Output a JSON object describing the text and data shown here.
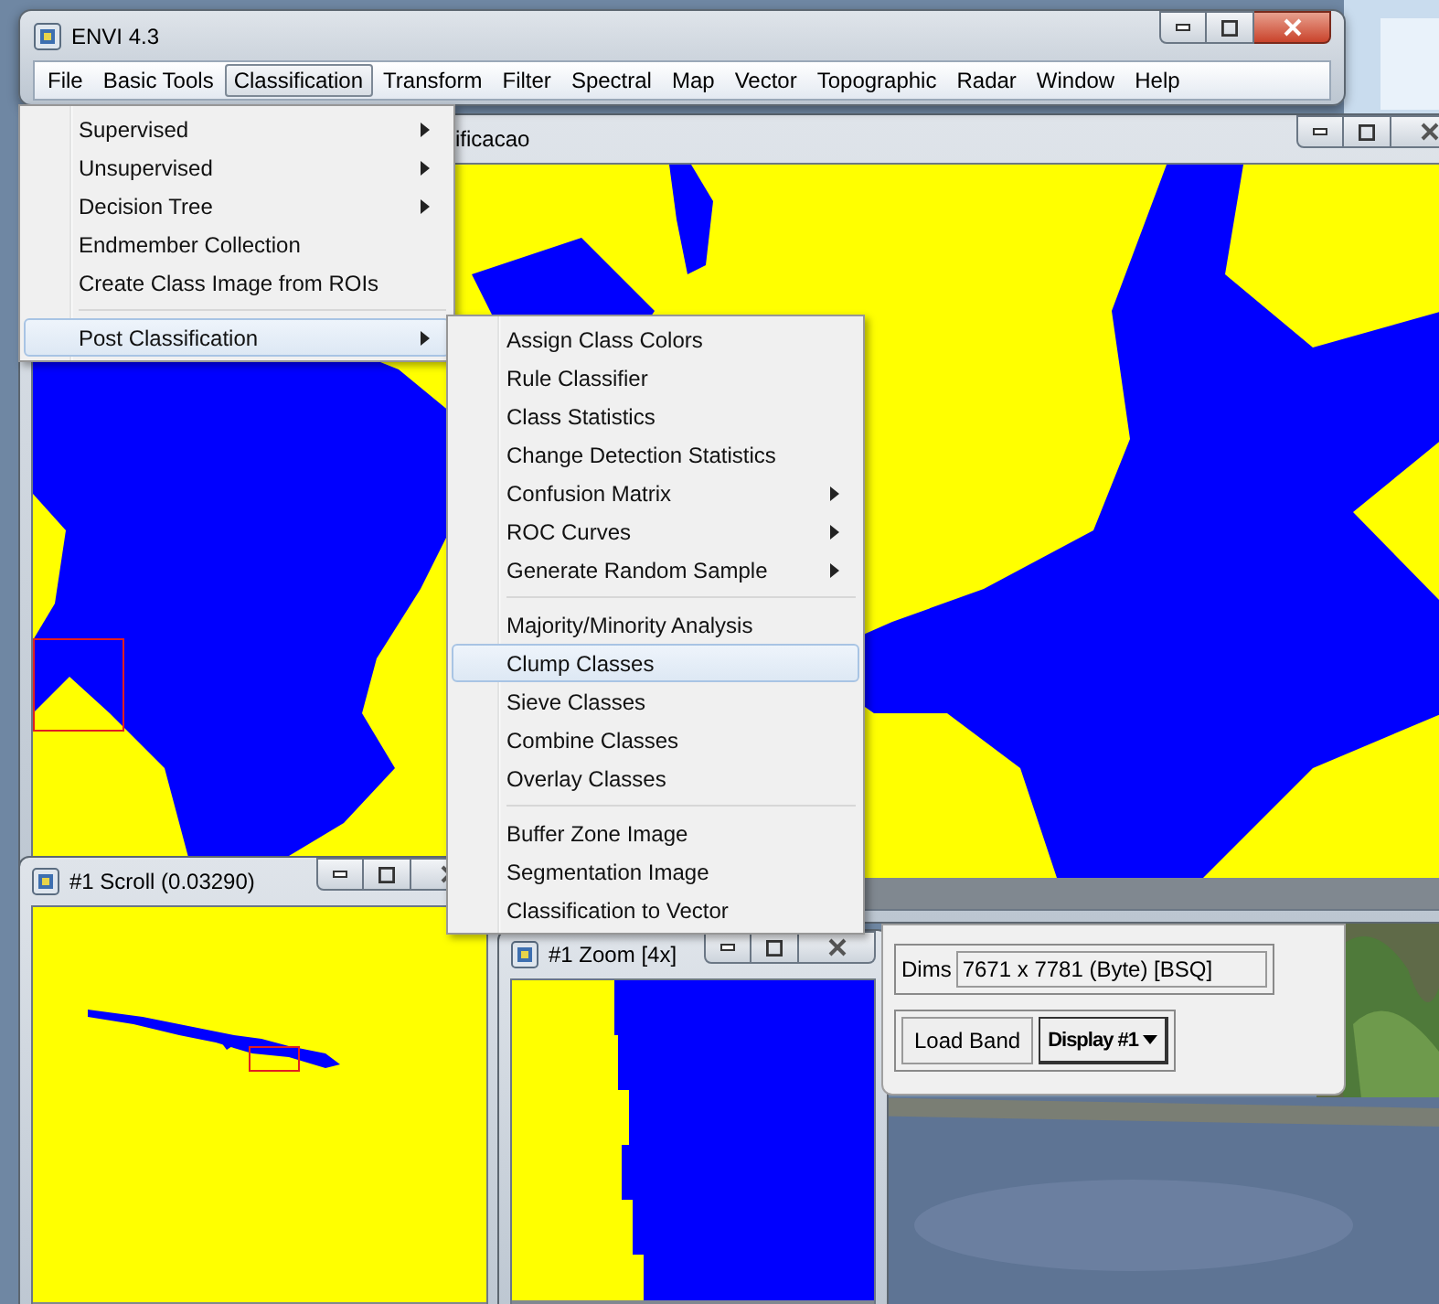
{
  "main_window": {
    "title": "ENVI 4.3",
    "menu": [
      {
        "label": "File",
        "selected": false
      },
      {
        "label": "Basic Tools",
        "selected": false
      },
      {
        "label": "Classification",
        "selected": true
      },
      {
        "label": "Transform",
        "selected": false
      },
      {
        "label": "Filter",
        "selected": false
      },
      {
        "label": "Spectral",
        "selected": false
      },
      {
        "label": "Map",
        "selected": false
      },
      {
        "label": "Vector",
        "selected": false
      },
      {
        "label": "Topographic",
        "selected": false
      },
      {
        "label": "Radar",
        "selected": false
      },
      {
        "label": "Window",
        "selected": false
      },
      {
        "label": "Help",
        "selected": false
      }
    ]
  },
  "classification_menu": {
    "groups": [
      {
        "items": [
          {
            "label": "Supervised",
            "submenu": true,
            "selected": false
          },
          {
            "label": "Unsupervised",
            "submenu": true,
            "selected": false
          },
          {
            "label": "Decision Tree",
            "submenu": true,
            "selected": false
          },
          {
            "label": "Endmember Collection",
            "submenu": false,
            "selected": false
          },
          {
            "label": "Create Class Image from ROIs",
            "submenu": false,
            "selected": false
          }
        ]
      },
      {
        "items": [
          {
            "label": "Post Classification",
            "submenu": true,
            "selected": true
          }
        ]
      }
    ]
  },
  "post_classification_menu": {
    "groups": [
      {
        "items": [
          {
            "label": "Assign Class Colors",
            "submenu": false,
            "selected": false
          },
          {
            "label": "Rule Classifier",
            "submenu": false,
            "selected": false
          },
          {
            "label": "Class Statistics",
            "submenu": false,
            "selected": false
          },
          {
            "label": "Change Detection Statistics",
            "submenu": false,
            "selected": false
          },
          {
            "label": "Confusion Matrix",
            "submenu": true,
            "selected": false
          },
          {
            "label": "ROC Curves",
            "submenu": true,
            "selected": false
          },
          {
            "label": "Generate Random Sample",
            "submenu": true,
            "selected": false
          }
        ]
      },
      {
        "items": [
          {
            "label": "Majority/Minority Analysis",
            "submenu": false,
            "selected": false
          },
          {
            "label": "Clump Classes",
            "submenu": false,
            "selected": true
          },
          {
            "label": "Sieve Classes",
            "submenu": false,
            "selected": false
          },
          {
            "label": "Combine Classes",
            "submenu": false,
            "selected": false
          },
          {
            "label": "Overlay Classes",
            "submenu": false,
            "selected": false
          }
        ]
      },
      {
        "items": [
          {
            "label": "Buffer Zone Image",
            "submenu": false,
            "selected": false
          },
          {
            "label": "Segmentation Image",
            "submenu": false,
            "selected": false
          },
          {
            "label": "Classification to Vector",
            "submenu": false,
            "selected": false
          }
        ]
      }
    ]
  },
  "image_window": {
    "title": "ificacao"
  },
  "scroll_window": {
    "title": "#1 Scroll (0.03290)"
  },
  "zoom_window": {
    "title": "#1 Zoom [4x]"
  },
  "file_panel": {
    "dims_label": "Dims",
    "dims_value": "7671 x 7781 (Byte) [BSQ]",
    "load_button": "Load Band",
    "display_dropdown": "Display #1"
  }
}
